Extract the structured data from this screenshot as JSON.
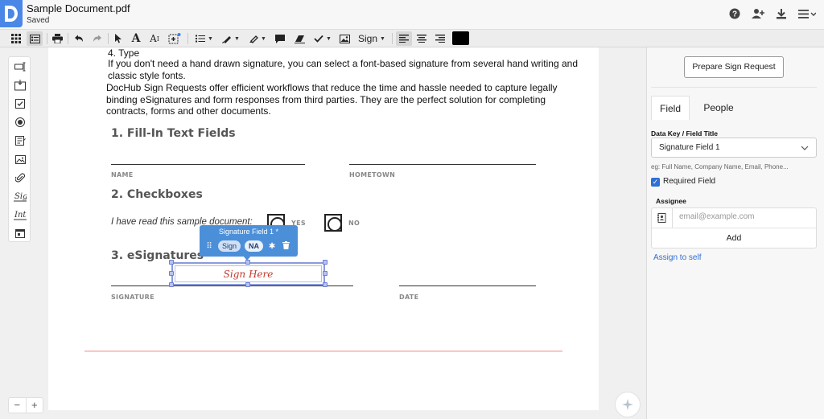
{
  "app": {
    "doc_title": "Sample Document.pdf",
    "status": "Saved"
  },
  "header_icons": [
    "help-icon",
    "add-user-icon",
    "download-icon",
    "menu-icon"
  ],
  "toolbar": {
    "sign_label": "Sign",
    "color_value": "#000000",
    "tools": [
      "grid-icon",
      "thumbnails-icon",
      "print-icon",
      "undo-icon",
      "redo-icon",
      "select-icon",
      "text-icon",
      "text-size-icon",
      "add-field-icon",
      "list-icon",
      "draw-icon",
      "highlight-icon",
      "comment-icon",
      "eraser-icon",
      "check-icon",
      "image-icon",
      "align-left-icon",
      "align-center-icon",
      "align-right-icon"
    ]
  },
  "rail": {
    "tools": [
      "text-field-icon",
      "dropdown-field-icon",
      "checkbox-field-icon",
      "radio-field-icon",
      "form-field-icon",
      "image-field-icon",
      "attachment-icon",
      "signature-icon",
      "initials-icon",
      "date-field-icon"
    ]
  },
  "zoom": {
    "minus": "−",
    "plus": "+"
  },
  "document": {
    "type_heading": "4.  Type",
    "type_body": "If you don't need a hand drawn signature, you can select a font-based signature from several hand writing and classic style fonts.",
    "intro": "DocHub Sign Requests offer efficient workflows that reduce the time and hassle needed to capture legally binding eSignatures and form responses from third parties.  They are the perfect solution for completing contracts, forms and other documents.",
    "section1": "1. Fill-In Text Fields",
    "name_label": "NAME",
    "hometown_label": "HOMETOWN",
    "section2": "2. Checkboxes",
    "checkbox_prompt": "I have read this sample document:",
    "yes_label": "YES",
    "no_label": "NO",
    "section3": "3. eSignatures",
    "signature_label": "SIGNATURE",
    "date_label": "DATE",
    "sig_placeholder": "Sign Here"
  },
  "field_popup": {
    "title": "Signature Field 1 *",
    "sign_btn": "Sign",
    "na_btn": "NA"
  },
  "right_panel": {
    "prepare_button": "Prepare Sign Request",
    "tabs": [
      {
        "label": "Field",
        "active": true
      },
      {
        "label": "People",
        "active": false
      }
    ],
    "data_key_label": "Data Key / Field Title",
    "field_title_value": "Signature Field 1",
    "hint": "eg: Full Name, Company Name, Email, Phone...",
    "required_label": "Required Field",
    "required_checked": true,
    "assignee_label": "Assignee",
    "email_placeholder": "email@example.com",
    "add_button": "Add",
    "assign_self": "Assign to self"
  },
  "colors": {
    "brand_blue": "#4a87e6",
    "popup_blue": "#4c8fd9",
    "link_blue": "#2f6fd6",
    "signature_red": "#c0392b"
  }
}
